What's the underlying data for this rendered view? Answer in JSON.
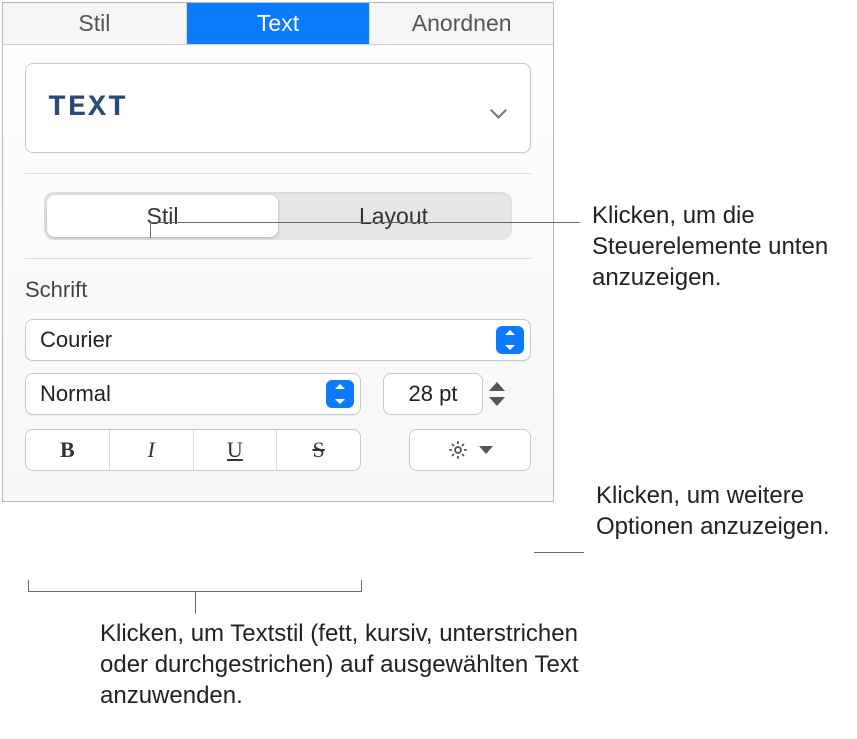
{
  "top_tabs": {
    "stil": "Stil",
    "text": "Text",
    "anordnen": "Anordnen"
  },
  "style_preview": "TEXT",
  "segmented": {
    "stil": "Stil",
    "layout": "Layout"
  },
  "font": {
    "section_label": "Schrift",
    "family": "Courier",
    "weight": "Normal",
    "size": "28 pt"
  },
  "style_btns": {
    "bold": "B",
    "italic": "I",
    "underline": "U",
    "strike": "S"
  },
  "callouts": {
    "stil_tab": "Klicken, um die Steuerelemente unten anzuzeigen.",
    "gear": "Klicken, um weitere Optionen anzuzeigen.",
    "styles": "Klicken, um Textstil (fett, kursiv, unterstrichen oder durchgestrichen) auf ausgewählten Text anzuwenden."
  }
}
